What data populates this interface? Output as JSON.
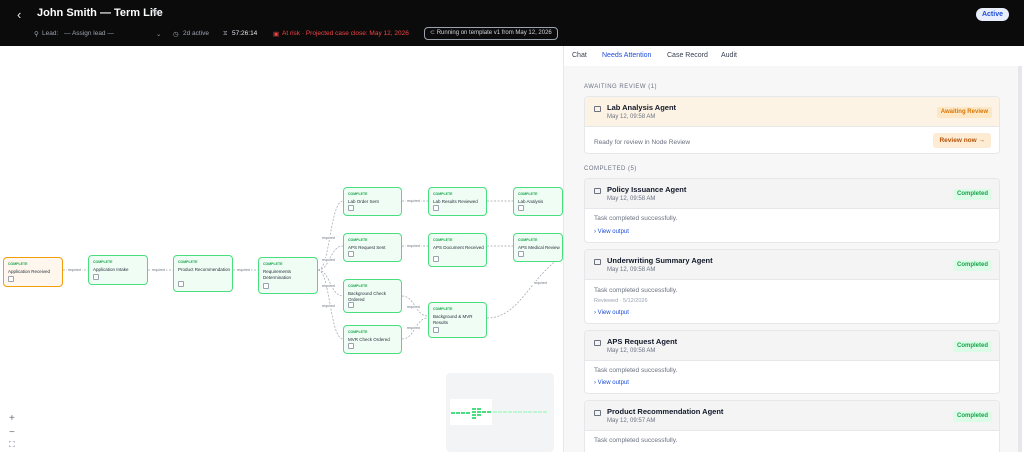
{
  "header": {
    "back_icon": "chevron-left-icon",
    "title": "John Smith — Term Life",
    "status_badge": "Active",
    "lead_label": "Lead:",
    "lead_value": "— Assign lead —",
    "age": "2d active",
    "timer": "57:26:14",
    "risk": "At risk · Projected case close: May 12, 2026",
    "template": "Running on template v1 from May 12, 2026"
  },
  "tabs": [
    {
      "label": "Chat"
    },
    {
      "label": "Needs Attention"
    },
    {
      "label": "Case Record"
    },
    {
      "label": "Audit"
    }
  ],
  "colors": {
    "accent": "#1d4ed8",
    "complete": "#16a34a",
    "awaiting": "#d97706",
    "risk": "#ef4444"
  },
  "workflow": {
    "status_label": "COMPLETE",
    "nodes": [
      {
        "name": "Application Received"
      },
      {
        "name": "Application Intake"
      },
      {
        "name": "Product Recommendation"
      },
      {
        "name": "Requirements Determination"
      },
      {
        "name": "Lab Order Sent"
      },
      {
        "name": "APS Request Sent"
      },
      {
        "name": "Background Check Ordered"
      },
      {
        "name": "MVR Check Ordered"
      },
      {
        "name": "Lab Results Reviewed"
      },
      {
        "name": "APS Document Received"
      },
      {
        "name": "Background & MVR Results"
      },
      {
        "name": "Lab Analysis"
      },
      {
        "name": "APS Medical Review"
      }
    ],
    "edge_labels": [
      "required",
      "required",
      "required",
      "required",
      "required",
      "required",
      "required",
      "required",
      "required",
      "required",
      "required",
      "required"
    ],
    "zoom_controls": [
      "+",
      "−",
      "⛶"
    ]
  },
  "attention": {
    "awaiting_header": "AWAITING REVIEW (1)",
    "awaiting": [
      {
        "agent": "Lab Analysis Agent",
        "time": "May 12, 09:58 AM",
        "status": "Awaiting Review",
        "message": "Ready for review in Node Review",
        "action": "Review now →"
      }
    ],
    "completed_header": "COMPLETED (5)",
    "completed": [
      {
        "agent": "Policy Issuance Agent",
        "time": "May 12, 09:58 AM",
        "status": "Completed",
        "message": "Task completed successfully.",
        "reviewed": "",
        "link": "View output"
      },
      {
        "agent": "Underwriting Summary Agent",
        "time": "May 12, 09:58 AM",
        "status": "Completed",
        "message": "Task completed successfully.",
        "reviewed": "Reviewed · 5/12/2026",
        "link": "View output"
      },
      {
        "agent": "APS Request Agent",
        "time": "May 12, 09:58 AM",
        "status": "Completed",
        "message": "Task completed successfully.",
        "reviewed": "",
        "link": "View output"
      },
      {
        "agent": "Product Recommendation Agent",
        "time": "May 12, 09:57 AM",
        "status": "Completed",
        "message": "Task completed successfully.",
        "reviewed": "",
        "link": ""
      }
    ]
  }
}
